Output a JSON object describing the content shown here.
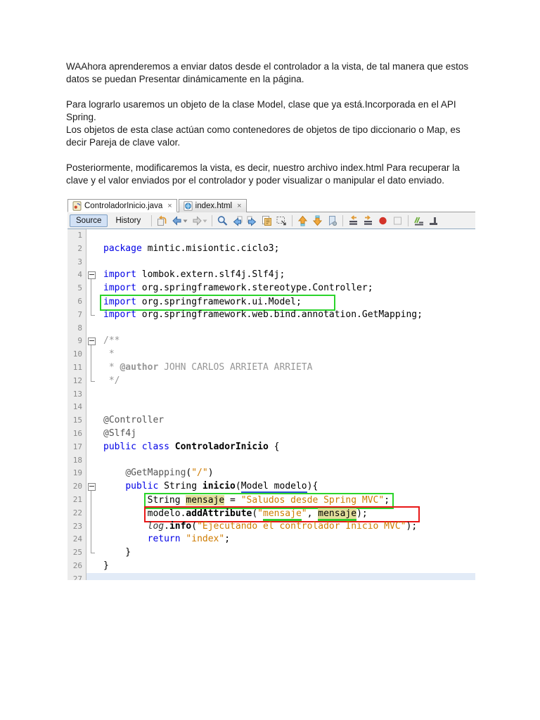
{
  "document": {
    "paragraphs": [
      [
        "WAAhora aprenderemos a enviar datos desde el controlador a la vista, de tal manera que estos datos se puedan Presentar dinámicamente en la página."
      ],
      [
        "Para lograrlo usaremos un objeto de la clase Model, clase que ya está.Incorporada en el API Spring.",
        "Los objetos de esta clase actúan como contenedores de objetos de tipo diccionario o Map, es decir Pareja de clave valor."
      ],
      [
        "Posteriormente, modificaremos la vista, es decir, nuestro archivo index.html Para recuperar la clave y el valor enviados por el controlador y poder visualizar o manipular el dato enviado."
      ]
    ]
  },
  "ide": {
    "tabs": [
      {
        "label": "ControladorInicio.java",
        "icon": "java-file-icon",
        "close": "×",
        "active": true
      },
      {
        "label": "index.html",
        "icon": "html-file-icon",
        "close": "×",
        "active": false
      }
    ],
    "toolbar": {
      "source_label": "Source",
      "history_label": "History",
      "groups": [
        [
          "last-edit-icon",
          "back-icon",
          "forward-icon"
        ],
        [
          "find-icon",
          "find-prev-icon",
          "find-next-icon",
          "find-selection-icon",
          "rect-select-icon"
        ],
        [
          "prev-bookmark-icon",
          "next-bookmark-icon",
          "toggle-bookmark-icon"
        ],
        [
          "shift-left-icon",
          "shift-right-icon",
          "record-macro-icon",
          "stop-macro-icon"
        ],
        [
          "comment-icon",
          "uncomment-icon"
        ]
      ]
    },
    "colors": {
      "keyword": "#0000E6",
      "string": "#CE7B00",
      "comment": "#969696",
      "occurrence_highlight": "#E3DF9C",
      "annotation_box_green": "#2BD42B",
      "annotation_box_red": "#E81717",
      "underline_blue": "#2F55D4",
      "underline_green": "#2FCC2F",
      "current_line": "#E2EBF7"
    },
    "editor": {
      "lines": [
        {
          "n": 1,
          "fold": "",
          "segs": []
        },
        {
          "n": 2,
          "fold": "",
          "segs": [
            [
              "kw",
              "package"
            ],
            [
              "pl",
              " mintic.misiontic.ciclo3;"
            ]
          ]
        },
        {
          "n": 3,
          "fold": "",
          "segs": []
        },
        {
          "n": 4,
          "fold": "open",
          "segs": [
            [
              "kw",
              "import"
            ],
            [
              "pl",
              " lombok.extern.slf4j.Slf4j;"
            ]
          ]
        },
        {
          "n": 5,
          "fold": "line",
          "segs": [
            [
              "kw",
              "import"
            ],
            [
              "pl",
              " org.springframework.stereotype.Controller;"
            ]
          ]
        },
        {
          "n": 6,
          "fold": "line",
          "box": "green",
          "segs": [
            [
              "kw",
              "import"
            ],
            [
              "pl",
              " org.springframework.ui.Model;"
            ]
          ]
        },
        {
          "n": 7,
          "fold": "end",
          "segs": [
            [
              "kw",
              "import"
            ],
            [
              "pl",
              " org.springframework.web.bind.annotation.GetMapping;"
            ]
          ]
        },
        {
          "n": 8,
          "fold": "",
          "segs": []
        },
        {
          "n": 9,
          "fold": "open",
          "segs": [
            [
              "com",
              "/**"
            ]
          ]
        },
        {
          "n": 10,
          "fold": "line",
          "segs": [
            [
              "com",
              " *"
            ]
          ]
        },
        {
          "n": 11,
          "fold": "line",
          "segs": [
            [
              "com",
              " * "
            ],
            [
              "comb",
              "@author"
            ],
            [
              "com",
              " JOHN CARLOS ARRIETA ARRIETA"
            ]
          ]
        },
        {
          "n": 12,
          "fold": "end",
          "segs": [
            [
              "com",
              " */"
            ]
          ]
        },
        {
          "n": 13,
          "fold": "",
          "segs": []
        },
        {
          "n": 14,
          "fold": "",
          "segs": []
        },
        {
          "n": 15,
          "fold": "",
          "segs": [
            [
              "ann",
              "@Controller"
            ]
          ]
        },
        {
          "n": 16,
          "fold": "",
          "segs": [
            [
              "ann",
              "@Slf4j"
            ]
          ]
        },
        {
          "n": 17,
          "fold": "",
          "segs": [
            [
              "kw",
              "public class "
            ],
            [
              "bold",
              "ControladorInicio"
            ],
            [
              "pl",
              " {"
            ]
          ]
        },
        {
          "n": 18,
          "fold": "",
          "segs": []
        },
        {
          "n": 19,
          "fold": "",
          "segs": [
            [
              "pl",
              "    "
            ],
            [
              "ann",
              "@GetMapping"
            ],
            [
              "pl",
              "("
            ],
            [
              "str",
              "\"/\""
            ],
            [
              "pl",
              ")"
            ]
          ]
        },
        {
          "n": 20,
          "fold": "open",
          "segs": [
            [
              "pl",
              "    "
            ],
            [
              "kw",
              "public"
            ],
            [
              "pl",
              " String "
            ],
            [
              "bold",
              "inicio"
            ],
            [
              "pl",
              "("
            ],
            [
              "ulb",
              "Model modelo"
            ],
            [
              "pl",
              "){"
            ]
          ]
        },
        {
          "n": 21,
          "fold": "line",
          "box": "green",
          "segs": [
            [
              "pl",
              "        "
            ],
            [
              "pl",
              "String "
            ],
            [
              "hl",
              "mensaje"
            ],
            [
              "pl",
              " = "
            ],
            [
              "str",
              "\"Saludos desde Spring MVC\""
            ],
            [
              "pl",
              ";"
            ]
          ]
        },
        {
          "n": 22,
          "fold": "line",
          "box": "red",
          "segs": [
            [
              "pl",
              "        "
            ],
            [
              "pl",
              "modelo."
            ],
            [
              "bold",
              "addAttribute"
            ],
            [
              "pl",
              "("
            ],
            [
              "str",
              "\""
            ],
            [
              "ug",
              "mensaje"
            ],
            [
              "str",
              "\""
            ],
            [
              "pl",
              ", "
            ],
            [
              "hg",
              "mensaje"
            ],
            [
              "pl",
              ");"
            ]
          ]
        },
        {
          "n": 23,
          "fold": "line",
          "segs": [
            [
              "pl",
              "        "
            ],
            [
              "ital",
              "log"
            ],
            [
              "pl",
              "."
            ],
            [
              "bold",
              "info"
            ],
            [
              "pl",
              "("
            ],
            [
              "str",
              "\"Ejecutando el controlador Inicio MVC\""
            ],
            [
              "pl",
              ");"
            ]
          ]
        },
        {
          "n": 24,
          "fold": "line",
          "segs": [
            [
              "pl",
              "        "
            ],
            [
              "kw",
              "return"
            ],
            [
              "pl",
              " "
            ],
            [
              "str",
              "\"index\""
            ],
            [
              "pl",
              ";"
            ]
          ]
        },
        {
          "n": 25,
          "fold": "end",
          "segs": [
            [
              "pl",
              "    }"
            ]
          ]
        },
        {
          "n": 26,
          "fold": "",
          "segs": [
            [
              "pl",
              "}"
            ]
          ]
        },
        {
          "n": 27,
          "fold": "",
          "current": true,
          "segs": []
        }
      ]
    }
  }
}
